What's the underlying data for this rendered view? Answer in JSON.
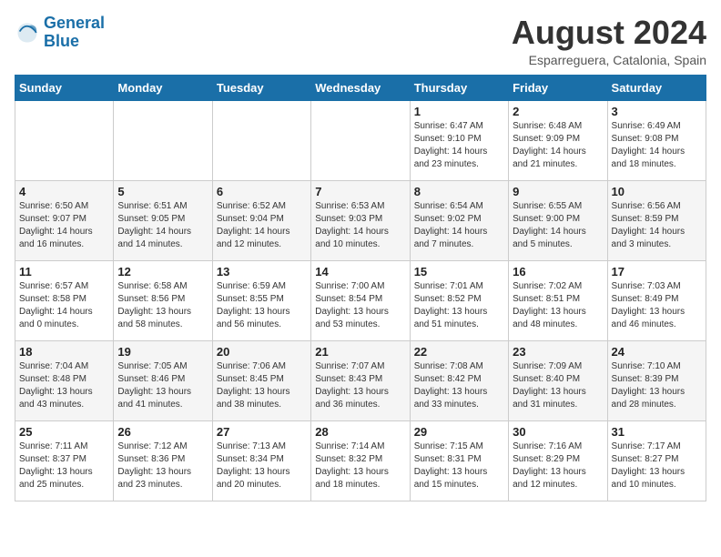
{
  "logo": {
    "line1": "General",
    "line2": "Blue"
  },
  "title": "August 2024",
  "location": "Esparreguera, Catalonia, Spain",
  "weekdays": [
    "Sunday",
    "Monday",
    "Tuesday",
    "Wednesday",
    "Thursday",
    "Friday",
    "Saturday"
  ],
  "weeks": [
    [
      {
        "day": "",
        "info": ""
      },
      {
        "day": "",
        "info": ""
      },
      {
        "day": "",
        "info": ""
      },
      {
        "day": "",
        "info": ""
      },
      {
        "day": "1",
        "info": "Sunrise: 6:47 AM\nSunset: 9:10 PM\nDaylight: 14 hours\nand 23 minutes."
      },
      {
        "day": "2",
        "info": "Sunrise: 6:48 AM\nSunset: 9:09 PM\nDaylight: 14 hours\nand 21 minutes."
      },
      {
        "day": "3",
        "info": "Sunrise: 6:49 AM\nSunset: 9:08 PM\nDaylight: 14 hours\nand 18 minutes."
      }
    ],
    [
      {
        "day": "4",
        "info": "Sunrise: 6:50 AM\nSunset: 9:07 PM\nDaylight: 14 hours\nand 16 minutes."
      },
      {
        "day": "5",
        "info": "Sunrise: 6:51 AM\nSunset: 9:05 PM\nDaylight: 14 hours\nand 14 minutes."
      },
      {
        "day": "6",
        "info": "Sunrise: 6:52 AM\nSunset: 9:04 PM\nDaylight: 14 hours\nand 12 minutes."
      },
      {
        "day": "7",
        "info": "Sunrise: 6:53 AM\nSunset: 9:03 PM\nDaylight: 14 hours\nand 10 minutes."
      },
      {
        "day": "8",
        "info": "Sunrise: 6:54 AM\nSunset: 9:02 PM\nDaylight: 14 hours\nand 7 minutes."
      },
      {
        "day": "9",
        "info": "Sunrise: 6:55 AM\nSunset: 9:00 PM\nDaylight: 14 hours\nand 5 minutes."
      },
      {
        "day": "10",
        "info": "Sunrise: 6:56 AM\nSunset: 8:59 PM\nDaylight: 14 hours\nand 3 minutes."
      }
    ],
    [
      {
        "day": "11",
        "info": "Sunrise: 6:57 AM\nSunset: 8:58 PM\nDaylight: 14 hours\nand 0 minutes."
      },
      {
        "day": "12",
        "info": "Sunrise: 6:58 AM\nSunset: 8:56 PM\nDaylight: 13 hours\nand 58 minutes."
      },
      {
        "day": "13",
        "info": "Sunrise: 6:59 AM\nSunset: 8:55 PM\nDaylight: 13 hours\nand 56 minutes."
      },
      {
        "day": "14",
        "info": "Sunrise: 7:00 AM\nSunset: 8:54 PM\nDaylight: 13 hours\nand 53 minutes."
      },
      {
        "day": "15",
        "info": "Sunrise: 7:01 AM\nSunset: 8:52 PM\nDaylight: 13 hours\nand 51 minutes."
      },
      {
        "day": "16",
        "info": "Sunrise: 7:02 AM\nSunset: 8:51 PM\nDaylight: 13 hours\nand 48 minutes."
      },
      {
        "day": "17",
        "info": "Sunrise: 7:03 AM\nSunset: 8:49 PM\nDaylight: 13 hours\nand 46 minutes."
      }
    ],
    [
      {
        "day": "18",
        "info": "Sunrise: 7:04 AM\nSunset: 8:48 PM\nDaylight: 13 hours\nand 43 minutes."
      },
      {
        "day": "19",
        "info": "Sunrise: 7:05 AM\nSunset: 8:46 PM\nDaylight: 13 hours\nand 41 minutes."
      },
      {
        "day": "20",
        "info": "Sunrise: 7:06 AM\nSunset: 8:45 PM\nDaylight: 13 hours\nand 38 minutes."
      },
      {
        "day": "21",
        "info": "Sunrise: 7:07 AM\nSunset: 8:43 PM\nDaylight: 13 hours\nand 36 minutes."
      },
      {
        "day": "22",
        "info": "Sunrise: 7:08 AM\nSunset: 8:42 PM\nDaylight: 13 hours\nand 33 minutes."
      },
      {
        "day": "23",
        "info": "Sunrise: 7:09 AM\nSunset: 8:40 PM\nDaylight: 13 hours\nand 31 minutes."
      },
      {
        "day": "24",
        "info": "Sunrise: 7:10 AM\nSunset: 8:39 PM\nDaylight: 13 hours\nand 28 minutes."
      }
    ],
    [
      {
        "day": "25",
        "info": "Sunrise: 7:11 AM\nSunset: 8:37 PM\nDaylight: 13 hours\nand 25 minutes."
      },
      {
        "day": "26",
        "info": "Sunrise: 7:12 AM\nSunset: 8:36 PM\nDaylight: 13 hours\nand 23 minutes."
      },
      {
        "day": "27",
        "info": "Sunrise: 7:13 AM\nSunset: 8:34 PM\nDaylight: 13 hours\nand 20 minutes."
      },
      {
        "day": "28",
        "info": "Sunrise: 7:14 AM\nSunset: 8:32 PM\nDaylight: 13 hours\nand 18 minutes."
      },
      {
        "day": "29",
        "info": "Sunrise: 7:15 AM\nSunset: 8:31 PM\nDaylight: 13 hours\nand 15 minutes."
      },
      {
        "day": "30",
        "info": "Sunrise: 7:16 AM\nSunset: 8:29 PM\nDaylight: 13 hours\nand 12 minutes."
      },
      {
        "day": "31",
        "info": "Sunrise: 7:17 AM\nSunset: 8:27 PM\nDaylight: 13 hours\nand 10 minutes."
      }
    ]
  ]
}
